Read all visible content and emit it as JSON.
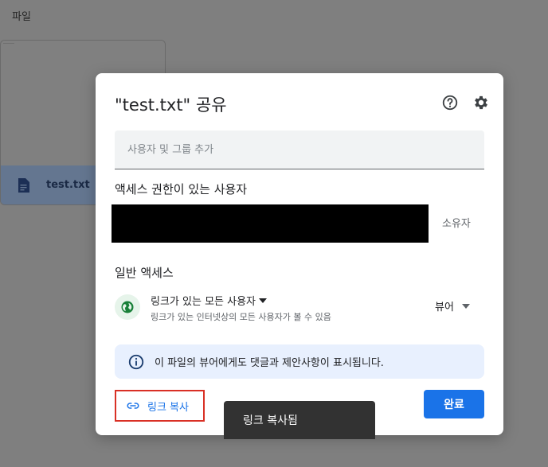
{
  "background": {
    "header": "파일",
    "file_card": {
      "name": "test.txt"
    }
  },
  "dialog": {
    "title": "\"test.txt\" 공유",
    "add_people_placeholder": "사용자 및 그룹 추가",
    "people_with_access_label": "액세스 권한이 있는 사용자",
    "owner_role": "소유자",
    "general_access_label": "일반 액세스",
    "link_access": {
      "option": "링크가 있는 모든 사용자",
      "description": "링크가 있는 인터넷상의 모든 사용자가 볼 수 있음",
      "role": "뷰어"
    },
    "info_banner": "이 파일의 뷰어에게도 댓글과 제안사항이 표시됩니다.",
    "copy_link_label": "링크 복사",
    "done_label": "완료"
  },
  "toast": {
    "message": "링크 복사됨"
  },
  "colors": {
    "accent": "#1a73e8",
    "highlight_border": "#d93025",
    "globe": "#188038",
    "info_bg": "#e8f0fe"
  },
  "icons": {
    "file": "document-icon",
    "help": "help-circle-icon",
    "settings": "gear-icon",
    "globe": "globe-icon",
    "info": "info-icon",
    "link": "link-icon"
  }
}
